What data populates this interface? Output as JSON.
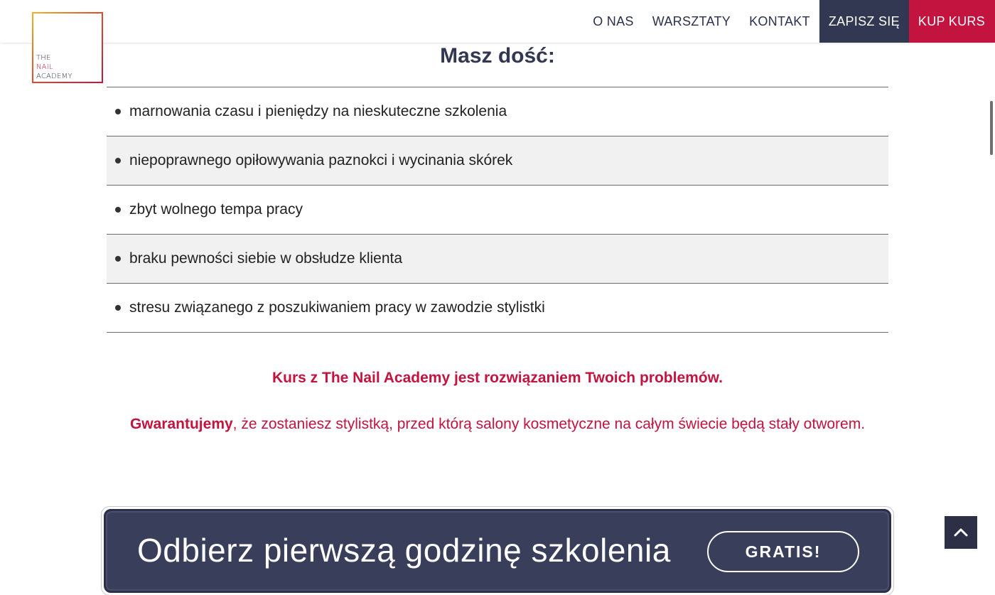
{
  "logo": {
    "line1": "THE",
    "line2": "NAIL",
    "line3": "ACADEMY"
  },
  "nav": {
    "about": "O NAS",
    "workshops": "WARSZTATY",
    "contact": "KONTAKT",
    "signup": "ZAPISZ SIĘ",
    "buy": "KUP KURS"
  },
  "section": {
    "title": "Masz dość:",
    "items": [
      "marnowania czasu i pieniędzy na nieskuteczne szkolenia",
      "niepoprawnego opiłowywania paznokci i wycinania skórek",
      "zbyt wolnego tempa pracy",
      "braku pewności siebie w obsłudze klienta",
      "stresu związanego z poszukiwaniem pracy w zawodzie stylistki"
    ]
  },
  "solution": "Kurs z The Nail Academy jest rozwiązaniem Twoich problemów.",
  "guarantee": {
    "bold": "Gwarantujemy",
    "rest": ", że zostaniesz stylistką, przed którą salony kosmetyczne na całym świecie będą stały otworem."
  },
  "cta": {
    "text": "Odbierz pierwszą godzinę szkolenia",
    "button": "GRATIS!"
  },
  "icons": {
    "back_to_top": "chevron-up-icon"
  },
  "colors": {
    "brand_navy": "#323752",
    "brand_red": "#c2143f"
  }
}
